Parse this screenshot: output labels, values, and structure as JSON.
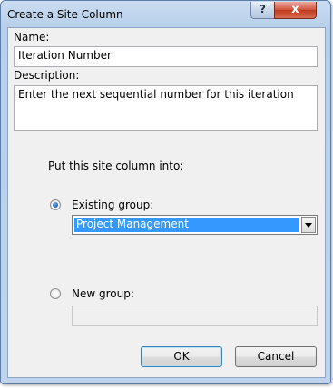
{
  "dialog": {
    "title": "Create a Site Column",
    "help_label": "?",
    "close_label": "x"
  },
  "form": {
    "name_label": "Name:",
    "name_value": "Iteration Number",
    "description_label": "Description:",
    "description_value": "Enter the next sequential number for this iteration",
    "put_into_label": "Put this site column into:",
    "existing_group_label": "Existing group:",
    "existing_group_selected": true,
    "existing_group_value": "Project Management",
    "new_group_label": "New group:",
    "new_group_selected": false,
    "new_group_value": ""
  },
  "buttons": {
    "ok_label": "OK",
    "cancel_label": "Cancel"
  }
}
